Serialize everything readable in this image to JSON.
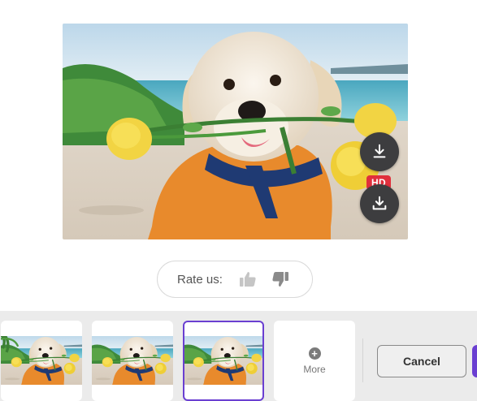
{
  "image": {
    "subject": "puppy-with-yellow-roses",
    "download_icon": "download-icon",
    "hd_download_icon": "download-hd-icon",
    "hd_badge": "HD"
  },
  "rating": {
    "label": "Rate us:",
    "like_icon": "thumbs-up-icon",
    "dislike_icon": "thumbs-down-icon"
  },
  "tray": {
    "more_label": "More",
    "more_icon": "plus-circle-icon",
    "cancel_label": "Cancel",
    "selected_thumbnail": 3
  },
  "colors": {
    "accent": "#6a3fd1",
    "hd_badge": "#e0303d",
    "button_dark": "#3d3d3f"
  }
}
